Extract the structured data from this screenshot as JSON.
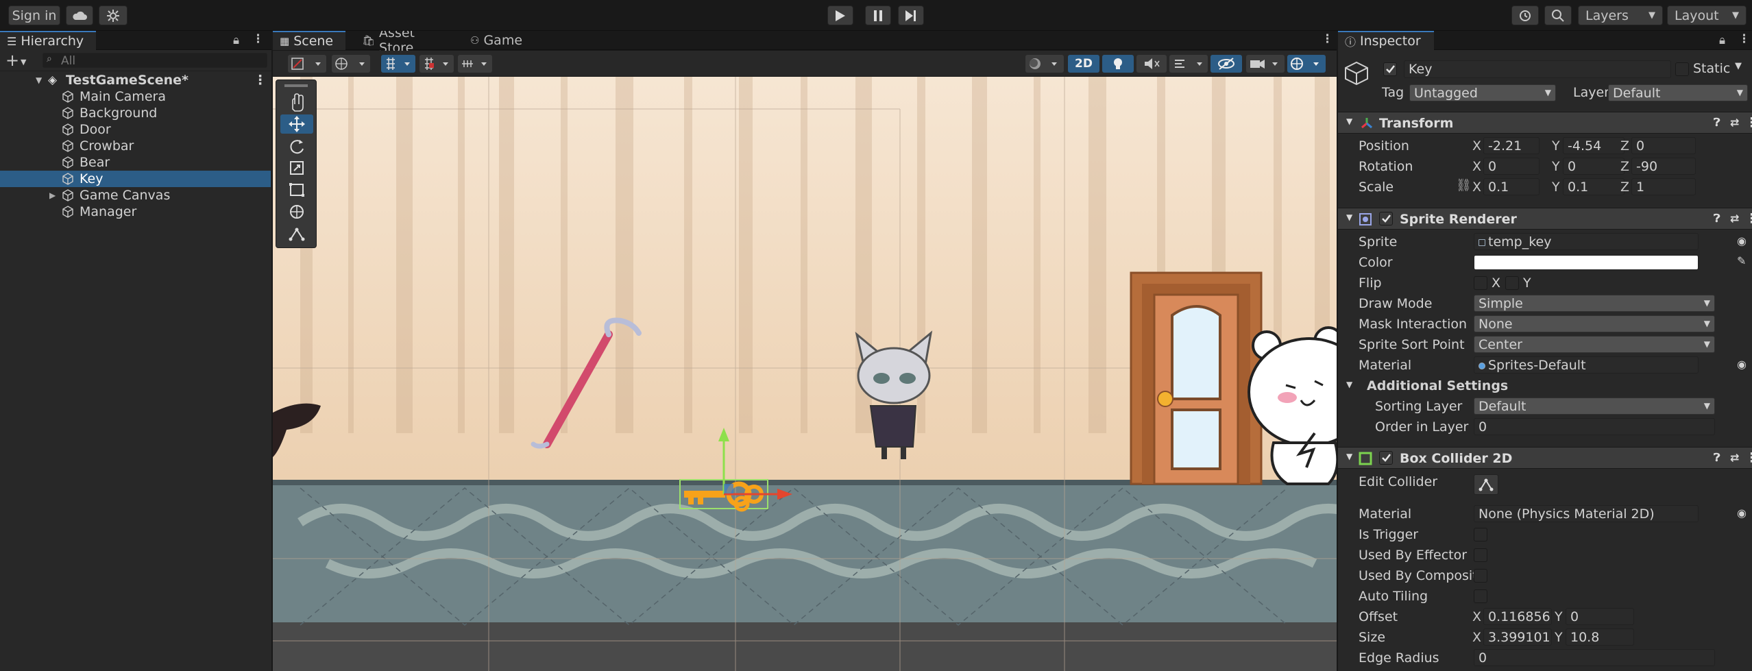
{
  "topbar": {
    "sign_in": "Sign in",
    "layers": "Layers",
    "layout": "Layout"
  },
  "hierarchy": {
    "tab": "Hierarchy",
    "search_placeholder": "All",
    "scene": "TestGameScene*",
    "items": [
      "Main Camera",
      "Background",
      "Door",
      "Crowbar",
      "Bear",
      "Key",
      "Game Canvas",
      "Manager"
    ],
    "selected": "Key"
  },
  "scene_view": {
    "tabs": [
      "Scene",
      "Asset Store",
      "Game"
    ],
    "mode_2d": "2D"
  },
  "inspector": {
    "tab": "Inspector",
    "object_name": "Key",
    "static_label": "Static",
    "tag_label": "Tag",
    "tag_value": "Untagged",
    "layer_label": "Layer",
    "layer_value": "Default",
    "transform": {
      "title": "Transform",
      "position_label": "Position",
      "position": {
        "x": "-2.21",
        "y": "-4.54",
        "z": "0"
      },
      "rotation_label": "Rotation",
      "rotation": {
        "x": "0",
        "y": "0",
        "z": "-90"
      },
      "scale_label": "Scale",
      "scale": {
        "x": "0.1",
        "y": "0.1",
        "z": "1"
      }
    },
    "sprite_renderer": {
      "title": "Sprite Renderer",
      "sprite_label": "Sprite",
      "sprite": "temp_key",
      "color_label": "Color",
      "flip_label": "Flip",
      "flip_x": "X",
      "flip_y": "Y",
      "draw_mode_label": "Draw Mode",
      "draw_mode": "Simple",
      "mask_label": "Mask Interaction",
      "mask": "None",
      "sort_point_label": "Sprite Sort Point",
      "sort_point": "Center",
      "material_label": "Material",
      "material": "Sprites-Default",
      "additional_label": "Additional Settings",
      "sorting_layer_label": "Sorting Layer",
      "sorting_layer": "Default",
      "order_label": "Order in Layer",
      "order": "0"
    },
    "box_collider": {
      "title": "Box Collider 2D",
      "edit_label": "Edit Collider",
      "material_label": "Material",
      "material": "None (Physics Material 2D)",
      "trigger_label": "Is Trigger",
      "effector_label": "Used By Effector",
      "composite_label": "Used By Composite",
      "tiling_label": "Auto Tiling",
      "offset_label": "Offset",
      "offset": {
        "x": "0.116856",
        "y": "0"
      },
      "size_label": "Size",
      "size": {
        "x": "3.399101",
        "y": "10.8"
      },
      "edge_label": "Edge Radius",
      "edge": "0"
    }
  }
}
